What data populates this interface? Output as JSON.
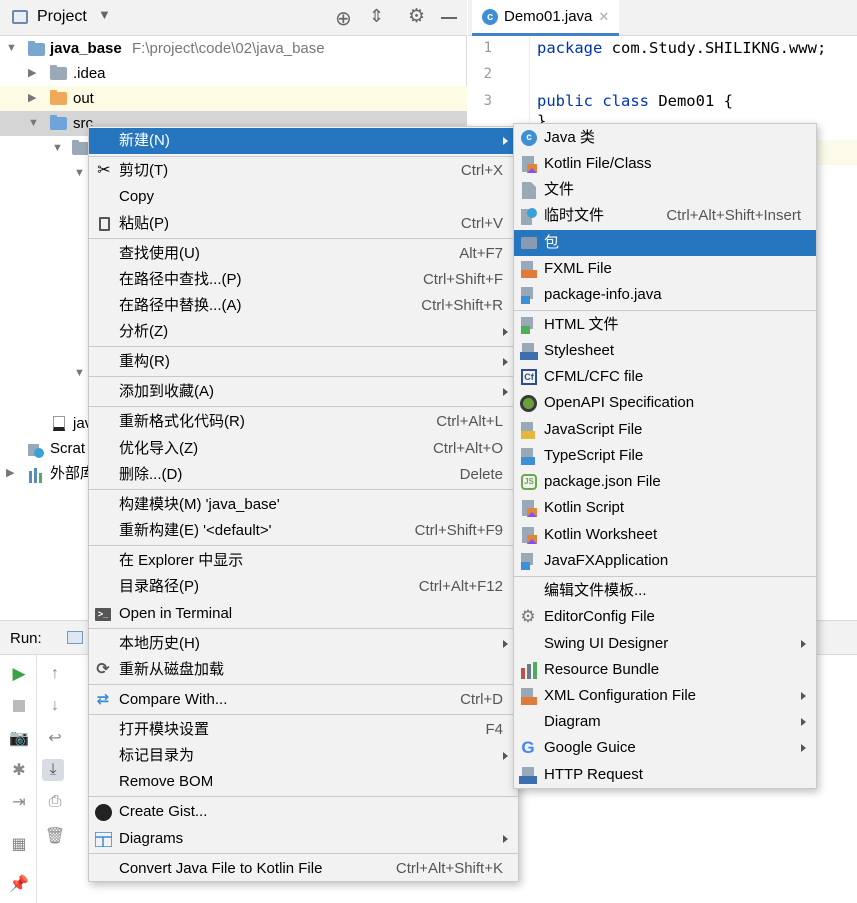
{
  "project": {
    "title": "Project",
    "root": {
      "name": "java_base",
      "path": "F:\\project\\code\\02\\java_base"
    },
    "items": [
      {
        "name": ".idea"
      },
      {
        "name": "out"
      },
      {
        "name": "src"
      },
      {
        "name": "jav"
      },
      {
        "name": "Scrat"
      },
      {
        "name": "外部库"
      }
    ]
  },
  "editor": {
    "tab": "Demo01.java",
    "lines": [
      {
        "num": "1",
        "kw": "package",
        "text": " com.Study.SHILIKNG.www;"
      },
      {
        "num": "2",
        "kw": "",
        "text": ""
      },
      {
        "num": "3",
        "kw": "public class",
        "text": " Demo01 {"
      },
      {
        "num": "",
        "kw": "",
        "text": "}"
      }
    ]
  },
  "run": {
    "label": "Run:"
  },
  "context_menu": {
    "items": [
      {
        "label": "新建(N)",
        "shortcut": "",
        "submenu": true,
        "icon": ""
      },
      {
        "label": "剪切(T)",
        "shortcut": "Ctrl+X",
        "icon": "scissors-icon"
      },
      {
        "label": "Copy",
        "shortcut": "",
        "icon": ""
      },
      {
        "label": "粘贴(P)",
        "shortcut": "Ctrl+V",
        "icon": "clipboard-icon"
      },
      {
        "label": "查找使用(U)",
        "shortcut": "Alt+F7"
      },
      {
        "label": "在路径中查找...(P)",
        "shortcut": "Ctrl+Shift+F"
      },
      {
        "label": "在路径中替换...(A)",
        "shortcut": "Ctrl+Shift+R"
      },
      {
        "label": "分析(Z)",
        "shortcut": "",
        "submenu": true
      },
      {
        "label": "重构(R)",
        "shortcut": "",
        "submenu": true
      },
      {
        "label": "添加到收藏(A)",
        "shortcut": "",
        "submenu": true
      },
      {
        "label": "重新格式化代码(R)",
        "shortcut": "Ctrl+Alt+L"
      },
      {
        "label": "优化导入(Z)",
        "shortcut": "Ctrl+Alt+O"
      },
      {
        "label": "删除...(D)",
        "shortcut": "Delete"
      },
      {
        "label": "构建模块(M) 'java_base'",
        "shortcut": ""
      },
      {
        "label": "重新构建(E) '<default>'",
        "shortcut": "Ctrl+Shift+F9"
      },
      {
        "label": "在 Explorer 中显示",
        "shortcut": ""
      },
      {
        "label": "目录路径(P)",
        "shortcut": "Ctrl+Alt+F12"
      },
      {
        "label": "Open in Terminal",
        "shortcut": ""
      },
      {
        "label": "本地历史(H)",
        "shortcut": "",
        "submenu": true
      },
      {
        "label": "重新从磁盘加载",
        "shortcut": ""
      },
      {
        "label": "Compare With...",
        "shortcut": "Ctrl+D"
      },
      {
        "label": "打开模块设置",
        "shortcut": "F4"
      },
      {
        "label": "标记目录为",
        "shortcut": "",
        "submenu": true
      },
      {
        "label": "Remove BOM",
        "shortcut": ""
      },
      {
        "label": "Create Gist...",
        "shortcut": ""
      },
      {
        "label": "Diagrams",
        "shortcut": "",
        "submenu": true
      },
      {
        "label": "Convert Java File to Kotlin File",
        "shortcut": "Ctrl+Alt+Shift+K"
      }
    ]
  },
  "new_submenu": {
    "items": [
      {
        "label": "Java 类",
        "shortcut": ""
      },
      {
        "label": "Kotlin File/Class",
        "shortcut": ""
      },
      {
        "label": "文件",
        "shortcut": ""
      },
      {
        "label": "临时文件",
        "shortcut": "Ctrl+Alt+Shift+Insert"
      },
      {
        "label": "包",
        "shortcut": ""
      },
      {
        "label": "FXML File",
        "shortcut": ""
      },
      {
        "label": "package-info.java",
        "shortcut": ""
      },
      {
        "label": "HTML 文件",
        "shortcut": ""
      },
      {
        "label": "Stylesheet",
        "shortcut": ""
      },
      {
        "label": "CFML/CFC file",
        "shortcut": ""
      },
      {
        "label": "OpenAPI Specification",
        "shortcut": ""
      },
      {
        "label": "JavaScript File",
        "shortcut": ""
      },
      {
        "label": "TypeScript File",
        "shortcut": ""
      },
      {
        "label": "package.json File",
        "shortcut": ""
      },
      {
        "label": "Kotlin Script",
        "shortcut": ""
      },
      {
        "label": "Kotlin Worksheet",
        "shortcut": ""
      },
      {
        "label": "JavaFXApplication",
        "shortcut": ""
      },
      {
        "label": "编辑文件模板...",
        "shortcut": ""
      },
      {
        "label": "EditorConfig File",
        "shortcut": ""
      },
      {
        "label": "Swing UI Designer",
        "shortcut": ""
      },
      {
        "label": "Resource Bundle",
        "shortcut": ""
      },
      {
        "label": "XML Configuration File",
        "shortcut": ""
      },
      {
        "label": "Diagram",
        "shortcut": ""
      },
      {
        "label": "Google Guice",
        "shortcut": ""
      },
      {
        "label": "HTTP Request",
        "shortcut": ""
      }
    ]
  },
  "colors": {
    "selection": "#2675bf",
    "menu_bg": "#f2f2f2",
    "keyword": "#0033b3",
    "folder_blue": "#6ea4d8",
    "folder_orange": "#f0a85a"
  }
}
